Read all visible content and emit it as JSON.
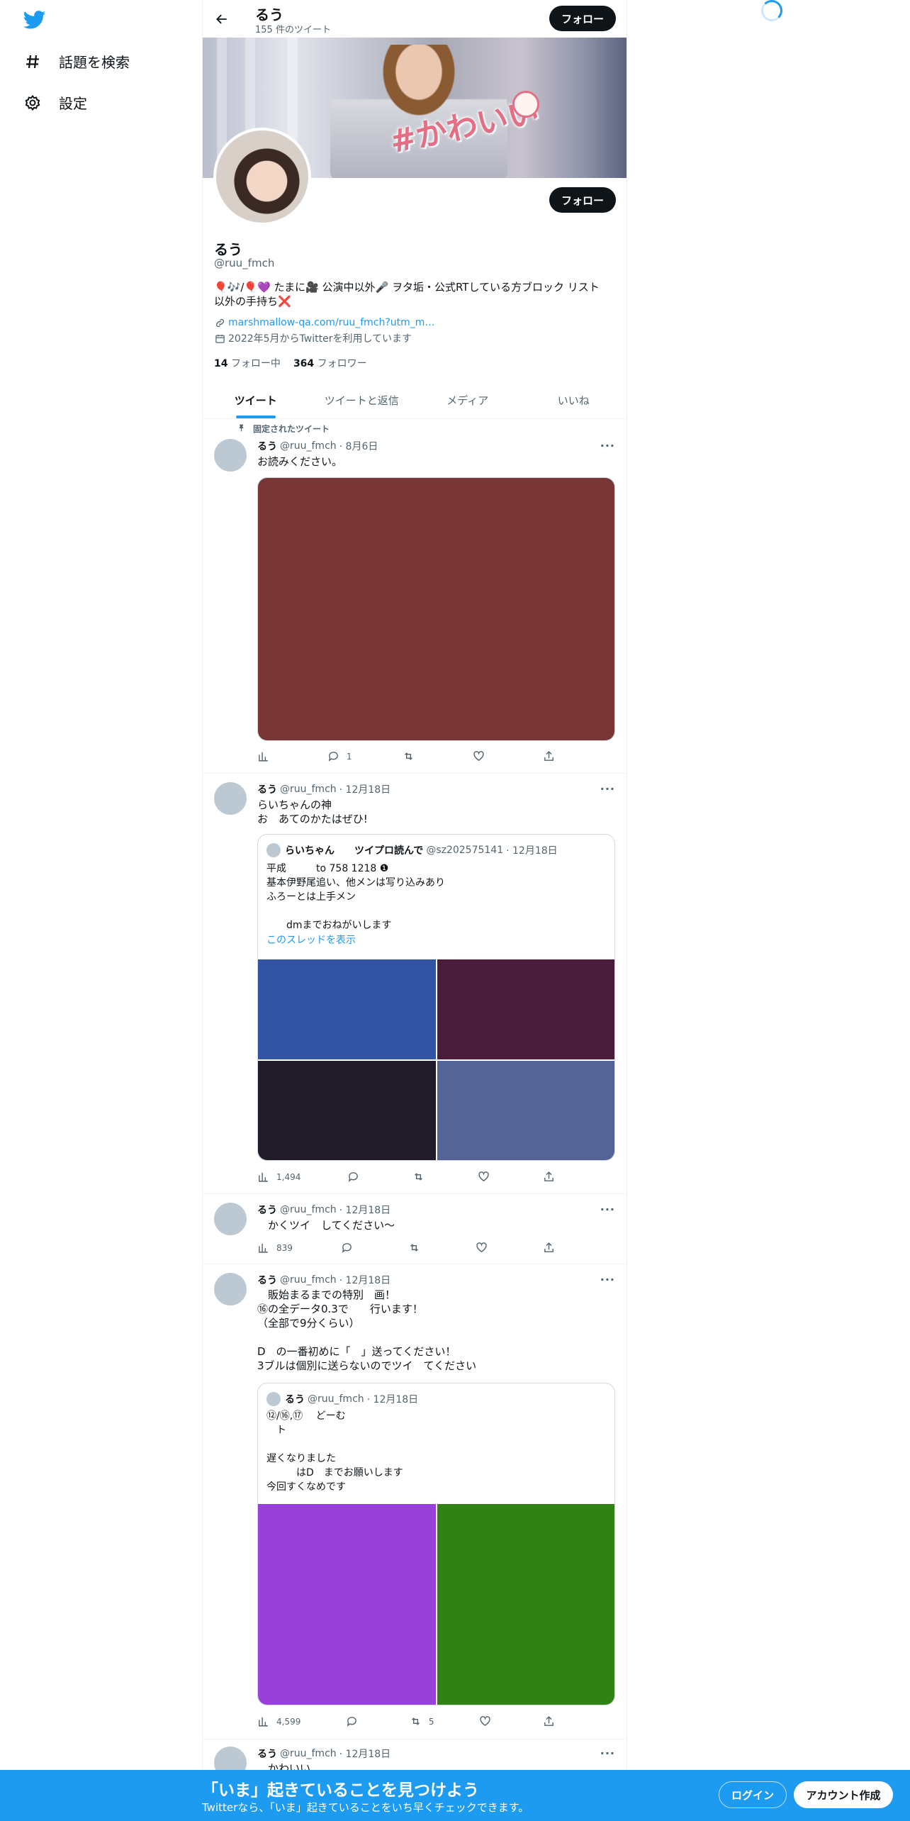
{
  "nav": {
    "items": [
      {
        "label": "話題を検索",
        "icon": "hash-icon"
      },
      {
        "label": "設定",
        "icon": "gear-icon"
      }
    ]
  },
  "header": {
    "name": "るう",
    "tweet_count": "155 件のツイート",
    "follow_label": "フォロー"
  },
  "profile": {
    "banner_text": "#かわいい",
    "name": "るう",
    "handle": "@ruu_fmch",
    "follow_label": "フォロー",
    "bio_line1": "🎈🎶/🎈💜 たまに🎥 公演中以外🎤 ヲタ垢・公式RTしている方ブロック リスト",
    "bio_line2": "以外の手持ち❌",
    "link": "marshmallow-qa.com/ruu_fmch?utm_m…",
    "joined": "2022年5月からTwitterを利用しています",
    "following_count": "14",
    "following_label": "フォロー中",
    "followers_count": "364",
    "followers_label": "フォロワー"
  },
  "tabs": [
    "ツイート",
    "ツイートと返信",
    "メディア",
    "いいね"
  ],
  "pinned_label": "固定されたツイート",
  "tweets": [
    {
      "name": "るう",
      "handle": "@ruu_fmch",
      "date": "· 8月6日",
      "text": "お読みください。",
      "media_color": "#783636",
      "views": "",
      "replies": "1",
      "retweets": "",
      "likes": ""
    },
    {
      "name": "るう",
      "handle": "@ruu_fmch",
      "date": "· 12月18日",
      "text": "らいちゃんの神\nお　あてのかたはぜひ!",
      "quote": {
        "name": "らいちゃん　　ツイプロ読んで",
        "handle": "@sz202575141",
        "date": "· 12月18日",
        "text": "平成　　　to 758 1218 ❶\n基本伊野尾追い、他メンは写り込みあり\nふろーとは上手メン\n\n　　dmまでおねがいします",
        "show_thread": "このスレッドを表示",
        "colors": [
          "#3354a4",
          "#481c3a",
          "#221c28",
          "#566396"
        ]
      },
      "views": "1,494",
      "replies": "",
      "retweets": "",
      "likes": ""
    },
    {
      "name": "るう",
      "handle": "@ruu_fmch",
      "date": "· 12月18日",
      "text": "　かくツイ　してください〜",
      "views": "839",
      "replies": "",
      "retweets": "",
      "likes": ""
    },
    {
      "name": "るう",
      "handle": "@ruu_fmch",
      "date": "· 12月18日",
      "text": "　販始まるまでの特別　画！\n⑯の全データ0.3で　　行います！\n（全部で9分くらい）\n\nD　の一番初めに「　」送ってください！\n3ブルは個別に送らないのでツイ　てください",
      "quote": {
        "name": "るう",
        "handle": "@ruu_fmch",
        "date": "· 12月18日",
        "text": "⑫/⑯,⑰　 どーむ\n　ト\n\n遅くなりました\n　　　はD　までお願いします\n今回すくなめです",
        "colors": [
          "#9841da",
          "#318114"
        ]
      },
      "views": "4,599",
      "replies": "",
      "retweets": "5",
      "likes": ""
    },
    {
      "name": "るう",
      "handle": "@ruu_fmch",
      "date": "· 12月18日",
      "text": "　かわいい",
      "views": "",
      "replies": "",
      "retweets": "",
      "likes": ""
    }
  ],
  "bottom_bar": {
    "title": "「いま」起きていることを見つけよう",
    "subtitle": "Twitterなら、「いま」起きていることをいち早くチェックできます。",
    "login": "ログイン",
    "signup": "アカウント作成"
  }
}
